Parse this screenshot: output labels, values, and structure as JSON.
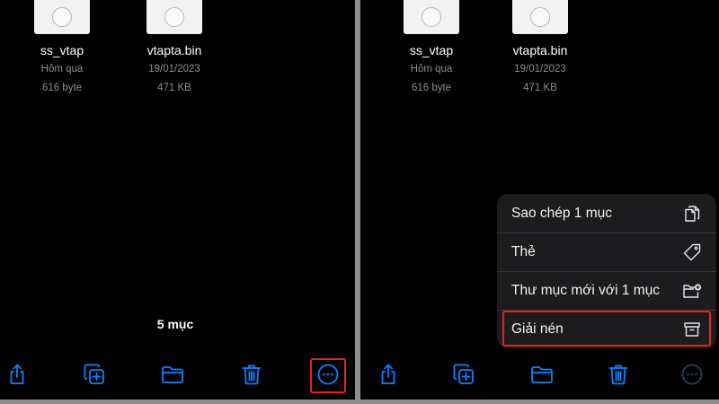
{
  "files": [
    {
      "name": "ss_vtap",
      "date": "Hôm qua",
      "size": "616 byte"
    },
    {
      "name": "vtapta.bin",
      "date": "19/01/2023",
      "size": "471 KB"
    }
  ],
  "status": {
    "item_count": "5 mục"
  },
  "toolbar": {
    "icons": [
      "share-icon",
      "duplicate-icon",
      "folder-icon",
      "trash-icon",
      "more-icon"
    ],
    "accent_color": "#0a84ff"
  },
  "context_menu": {
    "items": [
      {
        "label": "Sao chép 1 mục",
        "icon": "copy-icon"
      },
      {
        "label": "Thẻ",
        "icon": "tag-icon"
      },
      {
        "label": "Thư mục mới với 1 mục",
        "icon": "new-folder-icon"
      },
      {
        "label": "Giải nén",
        "icon": "archive-icon"
      }
    ]
  },
  "highlight_color": "#e2231a"
}
